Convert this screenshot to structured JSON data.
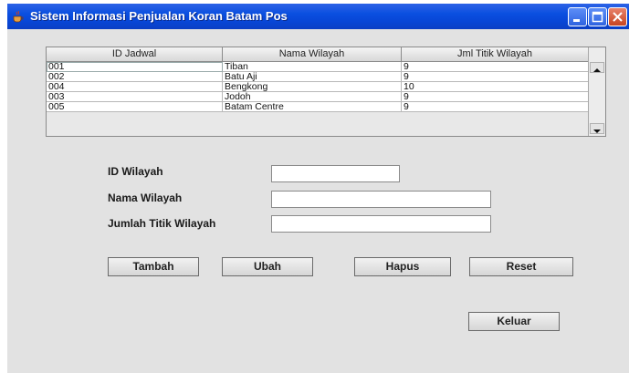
{
  "window": {
    "title": "Sistem Informasi Penjualan Koran Batam Pos"
  },
  "table": {
    "headers": [
      "ID Jadwal",
      "Nama Wilayah",
      "Jml Titik Wilayah"
    ],
    "rows": [
      [
        "001",
        "Tiban",
        "9"
      ],
      [
        "002",
        "Batu Aji",
        "9"
      ],
      [
        "004",
        "Bengkong",
        "10"
      ],
      [
        "003",
        "Jodoh",
        "9"
      ],
      [
        "005",
        "Batam Centre",
        "9"
      ]
    ]
  },
  "form": {
    "id_label": "ID Wilayah",
    "id_value": "",
    "nama_label": "Nama Wilayah",
    "nama_value": "",
    "jumlah_label": "Jumlah Titik Wilayah",
    "jumlah_value": ""
  },
  "buttons": {
    "tambah": "Tambah",
    "ubah": "Ubah",
    "hapus": "Hapus",
    "reset": "Reset",
    "keluar": "Keluar"
  },
  "colors": {
    "titlebar": "#0a4fe0",
    "window_bg": "#e2e2e2",
    "close_button": "#c84521"
  }
}
